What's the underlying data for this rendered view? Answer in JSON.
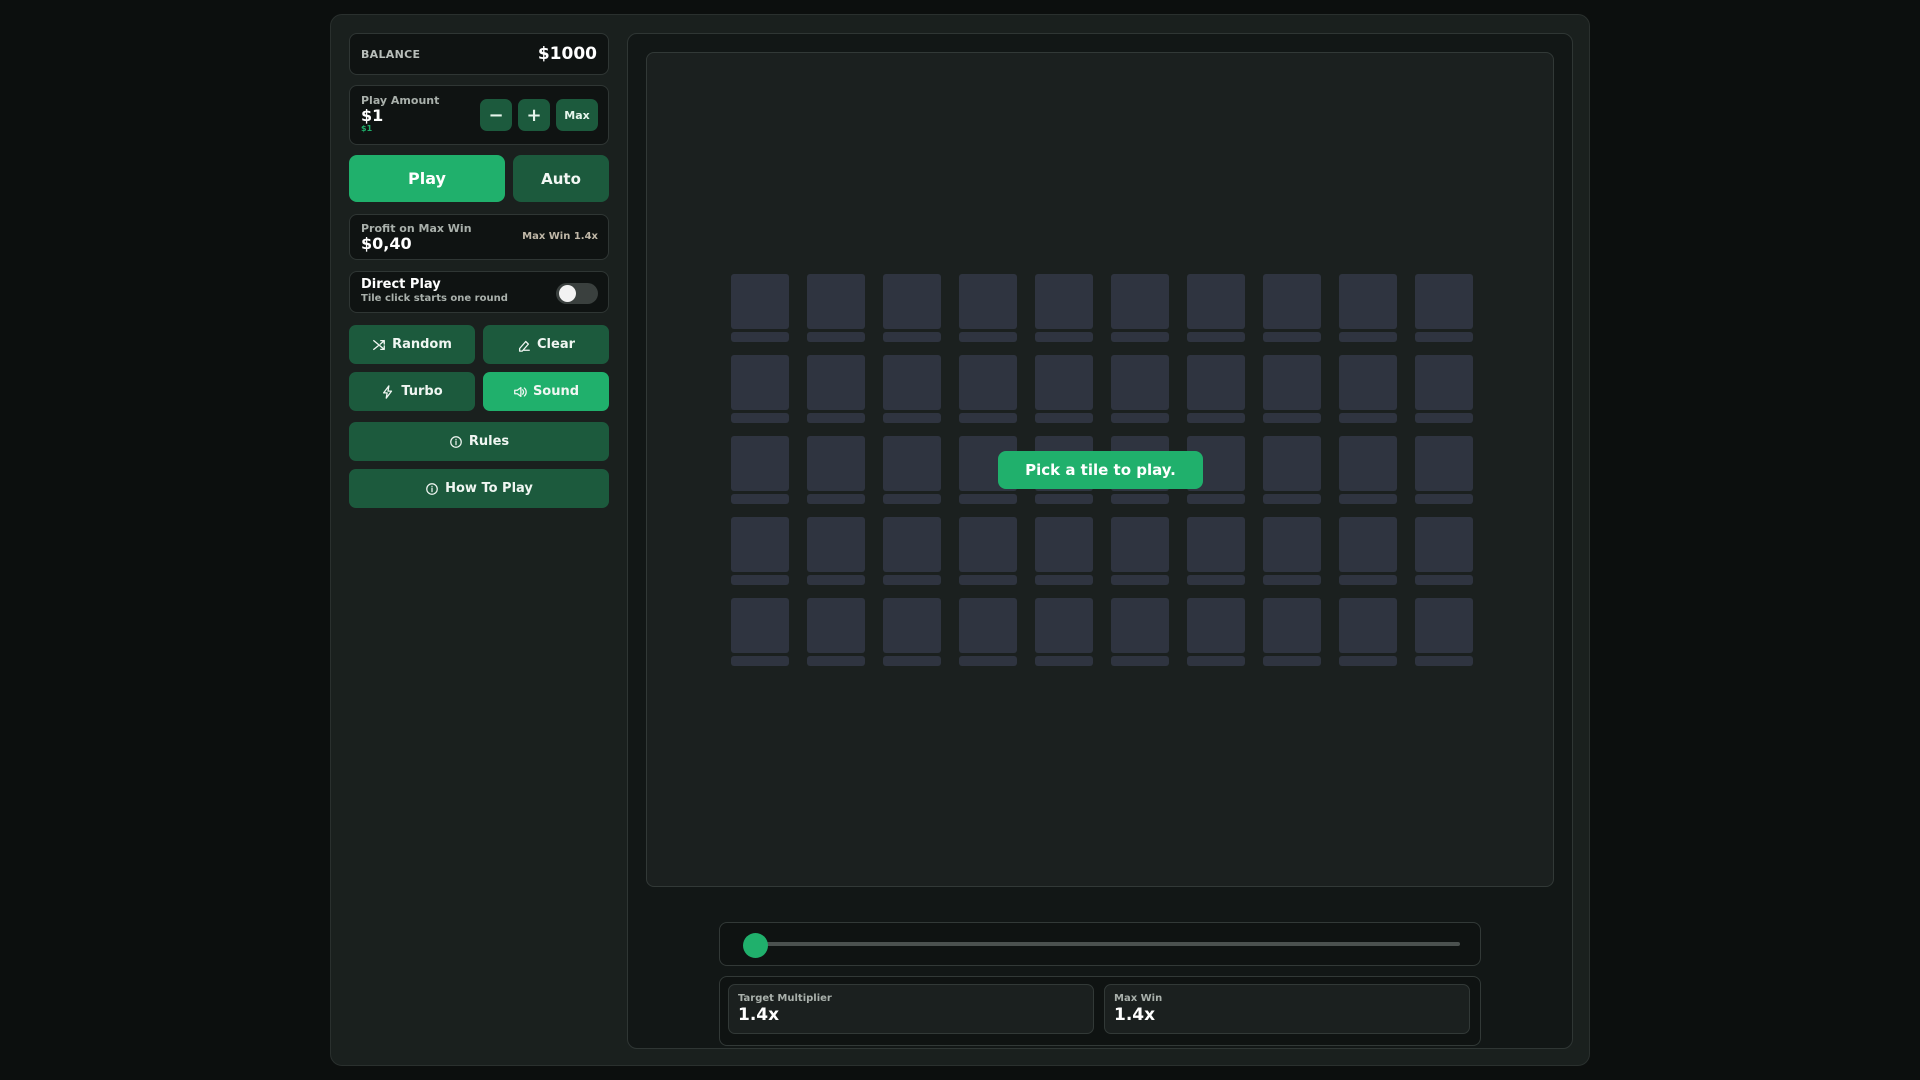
{
  "balance": {
    "label": "BALANCE",
    "value": "$1000"
  },
  "play_amount": {
    "label": "Play Amount",
    "value": "$1",
    "sub": "$1",
    "minus": "−",
    "plus": "+",
    "max": "Max"
  },
  "actions": {
    "play": "Play",
    "auto": "Auto"
  },
  "profit": {
    "label": "Profit on Max Win",
    "value": "$0,40",
    "max_win": "Max Win 1.4x"
  },
  "direct_play": {
    "title": "Direct Play",
    "subtitle": "Tile click starts one round",
    "enabled": false
  },
  "buttons": {
    "random": "Random",
    "clear": "Clear",
    "turbo": "Turbo",
    "sound": "Sound",
    "rules": "Rules",
    "how_to_play": "How To Play"
  },
  "board": {
    "rows": 5,
    "cols": 10,
    "message": "Pick a tile to play."
  },
  "slider": {
    "value": 0
  },
  "stats": {
    "target_multiplier_label": "Target Multiplier",
    "target_multiplier": "1.4x",
    "max_win_label": "Max Win",
    "max_win": "1.4x"
  },
  "colors": {
    "accent": "#20b06c",
    "button": "#1c5a3d",
    "tile": "#2f3440",
    "background": "#0c0f0e"
  },
  "icons": {
    "random": "shuffle-icon",
    "clear": "eraser-icon",
    "turbo": "lightning-icon",
    "sound": "speaker-icon",
    "rules": "info-icon",
    "how_to_play": "info-icon"
  }
}
